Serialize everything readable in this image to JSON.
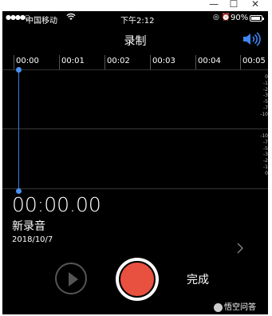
{
  "window": {
    "minimize": "—",
    "maximize": "☐",
    "close": "✕"
  },
  "statusbar": {
    "signal": "●●●●○",
    "carrier": "中国移动",
    "wifi_icon": "wifi-icon",
    "time": "下午2:12",
    "icons": "◎ ⏰",
    "battery": "90%"
  },
  "nav": {
    "title": "录制",
    "speaker_icon": "speaker-icon"
  },
  "timeline": {
    "ticks": [
      "00:00",
      "00:01",
      "00:02",
      "00:03",
      "00:04",
      "00:05"
    ]
  },
  "db_scale": {
    "upper": [
      "0",
      "-1",
      "-2",
      "-3",
      "-5",
      "-7",
      "-10"
    ],
    "lower": [
      "-10",
      "-7",
      "-5",
      "-3",
      "-2",
      "-1",
      "0"
    ]
  },
  "recording": {
    "elapsed": "00:00.00",
    "name": "新录音",
    "date": "2018/10/7"
  },
  "controls": {
    "done_label": "完成"
  },
  "watermark": {
    "text": "悟空问答"
  },
  "colors": {
    "accent": "#4a8ff0",
    "record": "#e8503f",
    "background": "#000000"
  }
}
